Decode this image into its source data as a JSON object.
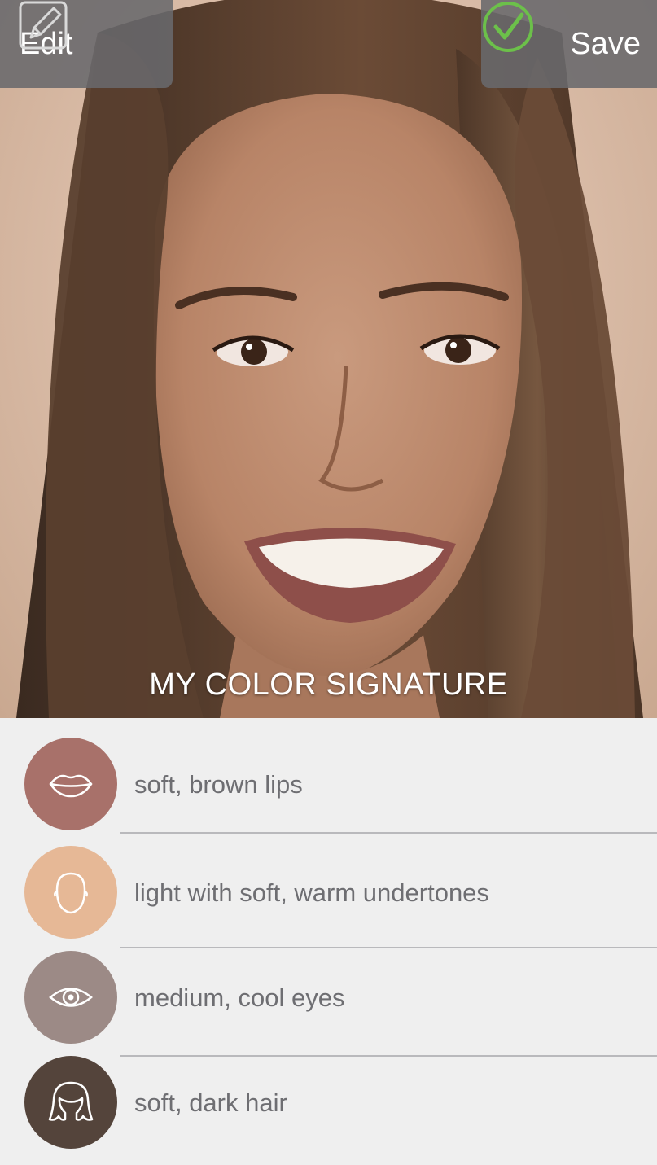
{
  "header": {
    "edit_label": "Edit",
    "save_label": "Save",
    "edit_icon": "pencil-square-icon",
    "save_icon": "checkmark-circle-icon",
    "save_accent": "#6cc04a"
  },
  "photo": {
    "caption": "MY COLOR SIGNATURE"
  },
  "signature": {
    "items": [
      {
        "label": "soft, brown lips",
        "icon": "lips-icon",
        "color": "#a8716a"
      },
      {
        "label": "light with soft, warm undertones",
        "icon": "face-icon",
        "color": "#e6b896"
      },
      {
        "label": "medium, cool eyes",
        "icon": "eye-icon",
        "color": "#9c8a86"
      },
      {
        "label": "soft, dark hair",
        "icon": "hair-icon",
        "color": "#54443b"
      }
    ]
  }
}
